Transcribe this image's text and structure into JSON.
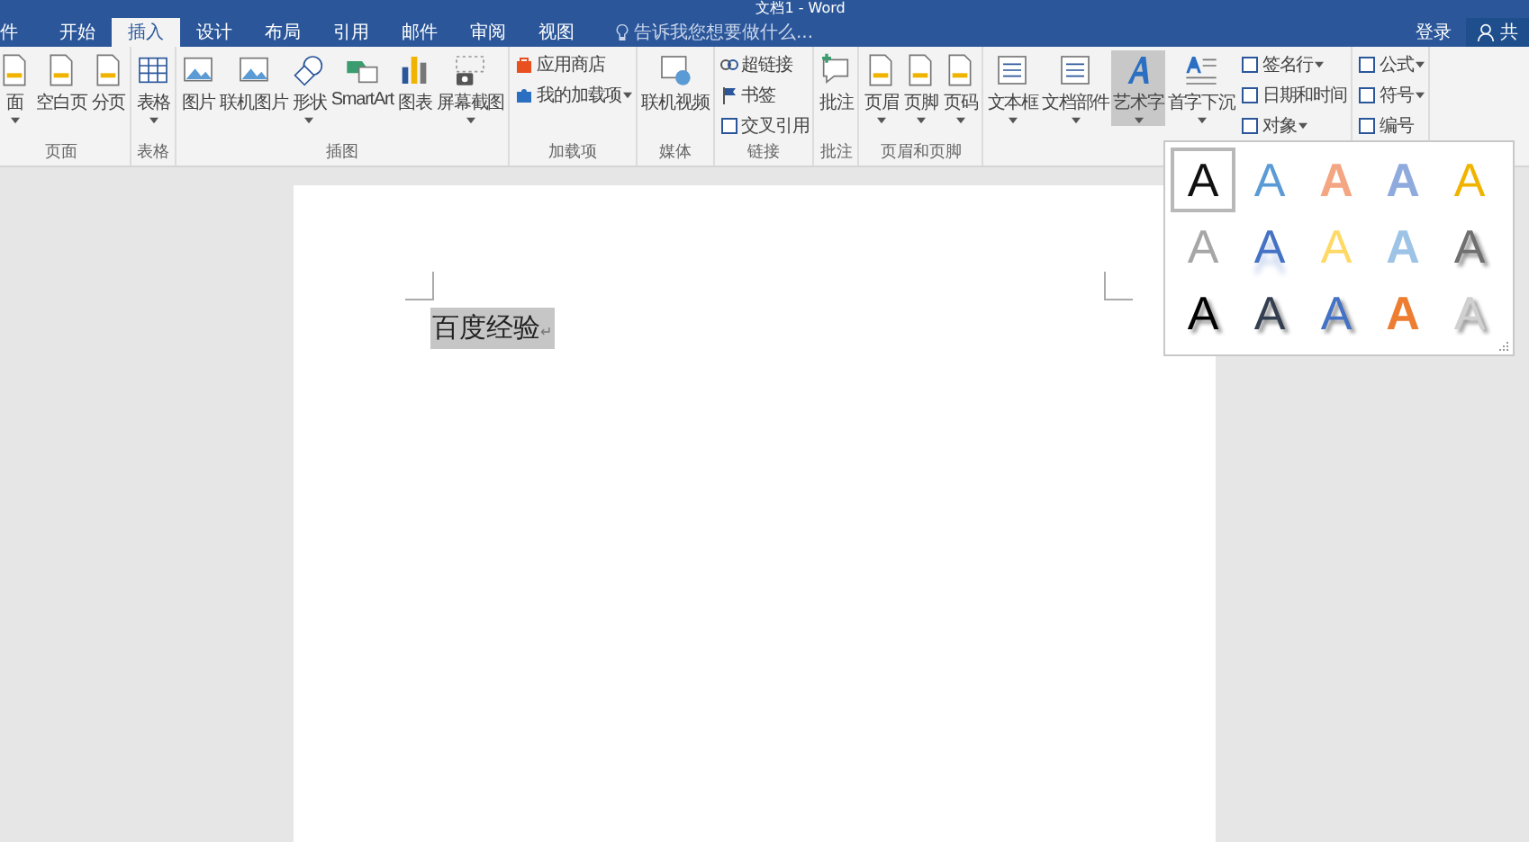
{
  "window": {
    "title": "文档1 - Word"
  },
  "tabs": [
    {
      "label": "件",
      "selected": false
    },
    {
      "label": "开始",
      "selected": false
    },
    {
      "label": "插入",
      "selected": true
    },
    {
      "label": "设计",
      "selected": false
    },
    {
      "label": "布局",
      "selected": false
    },
    {
      "label": "引用",
      "selected": false
    },
    {
      "label": "邮件",
      "selected": false
    },
    {
      "label": "审阅",
      "selected": false
    },
    {
      "label": "视图",
      "selected": false
    }
  ],
  "tell_me": {
    "placeholder": "告诉我您想要做什么..."
  },
  "account": {
    "sign_in": "登录",
    "share": "共"
  },
  "ribbon": {
    "groups": [
      {
        "label": "页面",
        "items": [
          {
            "kind": "large",
            "label": "面",
            "dropdown": true,
            "pressed": false
          },
          {
            "kind": "large",
            "label": "空白页",
            "dropdown": false,
            "pressed": false
          },
          {
            "kind": "large",
            "label": "分页",
            "dropdown": false,
            "pressed": false
          }
        ]
      },
      {
        "label": "表格",
        "items": [
          {
            "kind": "large",
            "label": "表格",
            "dropdown": true,
            "pressed": false
          }
        ]
      },
      {
        "label": "插图",
        "items": [
          {
            "kind": "large",
            "label": "图片",
            "dropdown": false,
            "pressed": false
          },
          {
            "kind": "large",
            "label": "联机图片",
            "dropdown": false,
            "pressed": false
          },
          {
            "kind": "large",
            "label": "形状",
            "dropdown": true,
            "pressed": false
          },
          {
            "kind": "large",
            "label": "SmartArt",
            "dropdown": false,
            "pressed": false
          },
          {
            "kind": "large",
            "label": "图表",
            "dropdown": false,
            "pressed": false
          },
          {
            "kind": "large",
            "label": "屏幕截图",
            "dropdown": true,
            "pressed": false
          }
        ]
      },
      {
        "label": "加载项",
        "items": [
          {
            "kind": "small",
            "label": "应用商店",
            "dropdown": false,
            "pressed": false
          },
          {
            "kind": "small",
            "label": "我的加载项",
            "dropdown": true,
            "pressed": false
          }
        ]
      },
      {
        "label": "媒体",
        "items": [
          {
            "kind": "large",
            "label": "联机视频",
            "dropdown": false,
            "pressed": false
          }
        ]
      },
      {
        "label": "链接",
        "items": [
          {
            "kind": "small",
            "label": "超链接",
            "dropdown": false,
            "pressed": false
          },
          {
            "kind": "small",
            "label": "书签",
            "dropdown": false,
            "pressed": false
          },
          {
            "kind": "small",
            "label": "交叉引用",
            "dropdown": false,
            "pressed": false
          }
        ]
      },
      {
        "label": "批注",
        "items": [
          {
            "kind": "large",
            "label": "批注",
            "dropdown": false,
            "pressed": false
          }
        ]
      },
      {
        "label": "页眉和页脚",
        "items": [
          {
            "kind": "large",
            "label": "页眉",
            "dropdown": true,
            "pressed": false
          },
          {
            "kind": "large",
            "label": "页脚",
            "dropdown": true,
            "pressed": false
          },
          {
            "kind": "large",
            "label": "页码",
            "dropdown": true,
            "pressed": false
          }
        ]
      },
      {
        "items": [
          {
            "kind": "large",
            "label": "文本框",
            "dropdown": true,
            "pressed": false
          },
          {
            "kind": "large",
            "label": "文档部件",
            "dropdown": true,
            "pressed": false
          },
          {
            "kind": "large",
            "label": "艺术字",
            "dropdown": true,
            "pressed": true
          },
          {
            "kind": "large",
            "label": "首字下沉",
            "dropdown": true,
            "pressed": false
          },
          {
            "kind": "small",
            "label": "签名行",
            "dropdown": true,
            "pressed": false
          },
          {
            "kind": "small",
            "label": "日期和时间",
            "dropdown": false,
            "pressed": false
          },
          {
            "kind": "small",
            "label": "对象",
            "dropdown": true,
            "pressed": false
          }
        ]
      },
      {
        "items": [
          {
            "kind": "small",
            "label": "公式",
            "dropdown": true,
            "pressed": false
          },
          {
            "kind": "small",
            "label": "符号",
            "dropdown": true,
            "pressed": false
          },
          {
            "kind": "small",
            "label": "编号",
            "dropdown": false,
            "pressed": false
          }
        ]
      }
    ]
  },
  "wordart_gallery": {
    "styles": [
      {
        "letter": "A",
        "kind": "fill",
        "color": "#111111",
        "selected": true
      },
      {
        "letter": "A",
        "kind": "fill",
        "color": "#5b9bd5",
        "selected": false
      },
      {
        "letter": "A",
        "kind": "outline",
        "color": "#f4a582",
        "selected": false
      },
      {
        "letter": "A",
        "kind": "outline",
        "color": "#8faadc",
        "selected": false
      },
      {
        "letter": "A",
        "kind": "fill",
        "color": "#f0b400",
        "selected": false
      },
      {
        "letter": "A",
        "kind": "fill",
        "color": "#a6a6a6",
        "selected": false
      },
      {
        "letter": "A",
        "kind": "reflection",
        "color": "#4472c4",
        "selected": false
      },
      {
        "letter": "A",
        "kind": "fill",
        "color": "#ffd966",
        "selected": false
      },
      {
        "letter": "A",
        "kind": "outline",
        "color": "#9dc3e6",
        "selected": false
      },
      {
        "letter": "A",
        "kind": "shadow",
        "color": "#6f6f6f",
        "selected": false
      },
      {
        "letter": "A",
        "kind": "shadow",
        "color": "#000000",
        "selected": false
      },
      {
        "letter": "A",
        "kind": "shadow",
        "color": "#333f50",
        "selected": false
      },
      {
        "letter": "A",
        "kind": "shadow",
        "color": "#4472c4",
        "selected": false
      },
      {
        "letter": "A",
        "kind": "outline",
        "color": "#ed7d31",
        "selected": false
      },
      {
        "letter": "A",
        "kind": "shadow",
        "color": "#d0d0d0",
        "selected": false
      }
    ]
  },
  "document": {
    "text": "百度经验",
    "text_selected": true,
    "paragraph_mark": "↵"
  }
}
